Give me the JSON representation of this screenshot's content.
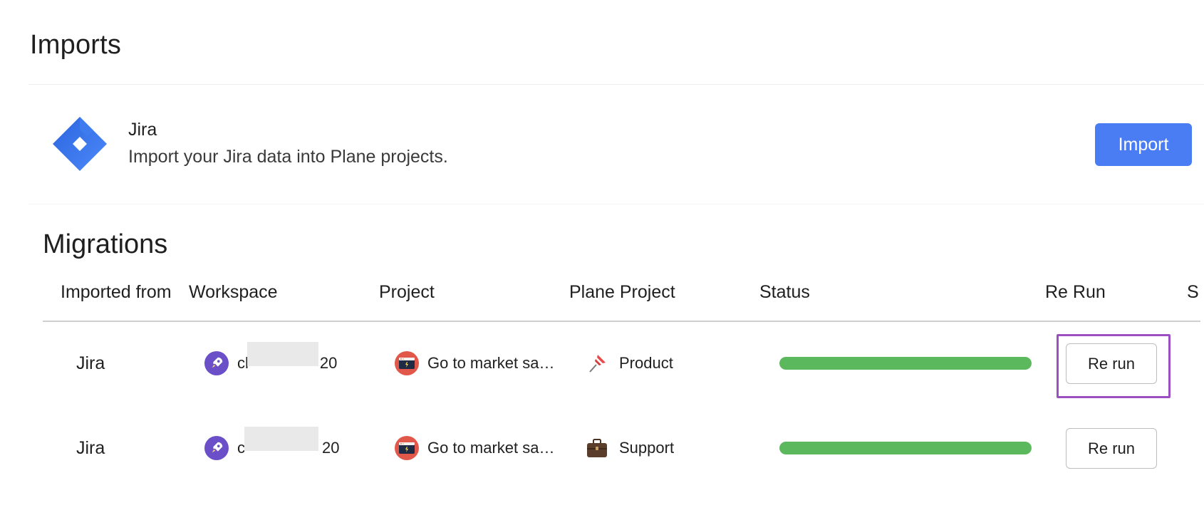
{
  "page": {
    "title": "Imports"
  },
  "provider": {
    "name": "Jira",
    "description": "Import your Jira data into Plane projects.",
    "import_label": "Import",
    "logo_icon": "jira-logo-icon",
    "accent_color": "#4a7cf3"
  },
  "migrations": {
    "title": "Migrations",
    "columns": [
      "Imported from",
      "Workspace",
      "Project",
      "Plane Project",
      "Status",
      "Re Run",
      "S"
    ],
    "rows": [
      {
        "source": "Jira",
        "workspace_prefix": "cl",
        "workspace_suffix": "20",
        "workspace_icon": "rocket-icon",
        "project": "Go to market sa…",
        "project_icon": "browser-window-icon",
        "plane_project": "Product",
        "plane_project_icon": "pushpin-icon",
        "status_progress": 1.0,
        "rerun_label": "Re run"
      },
      {
        "source": "Jira",
        "workspace_prefix": "c",
        "workspace_suffix": "20",
        "workspace_icon": "rocket-icon",
        "project": "Go to market sa…",
        "project_icon": "browser-window-icon",
        "plane_project": "Support",
        "plane_project_icon": "briefcase-icon",
        "status_progress": 1.0,
        "rerun_label": "Re run"
      }
    ],
    "status_color": "#5cb85c",
    "highlight_color": "#9b4fc0"
  }
}
